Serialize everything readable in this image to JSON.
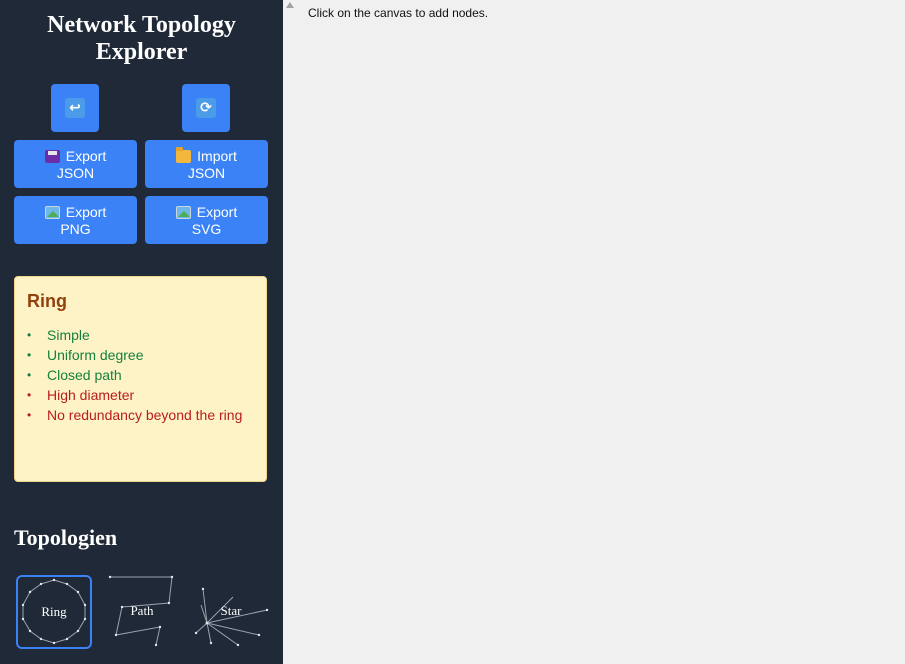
{
  "app": {
    "title": "Network Topology Explorer"
  },
  "toolbar": {
    "undo_icon": "undo-arrow-icon",
    "refresh_icon": "refresh-icon",
    "export_json": {
      "line1": "Export",
      "line2": "JSON",
      "icon": "floppy-disk-icon"
    },
    "import_json": {
      "line1": "Import",
      "line2": "JSON",
      "icon": "folder-icon"
    },
    "export_png": {
      "line1": "Export",
      "line2": "PNG",
      "icon": "image-icon"
    },
    "export_svg": {
      "line1": "Export",
      "line2": "SVG",
      "icon": "image-icon"
    }
  },
  "info": {
    "title": "Ring",
    "pros": [
      "Simple",
      "Uniform degree",
      "Closed path"
    ],
    "cons": [
      "High diameter",
      "No redundancy beyond the ring"
    ]
  },
  "topologies": {
    "heading": "Topologien",
    "items": [
      {
        "label": "Ring",
        "selected": true
      },
      {
        "label": "Path",
        "selected": false
      },
      {
        "label": "Star",
        "selected": false
      }
    ]
  },
  "canvas": {
    "hint": "Click on the canvas to add nodes."
  },
  "colors": {
    "sidebar_bg": "#1f2937",
    "button_bg": "#3b82f6",
    "card_bg": "#fef3c7",
    "pro_text": "#15803d",
    "con_text": "#b91c1c",
    "canvas_bg": "#f0f0f0"
  }
}
